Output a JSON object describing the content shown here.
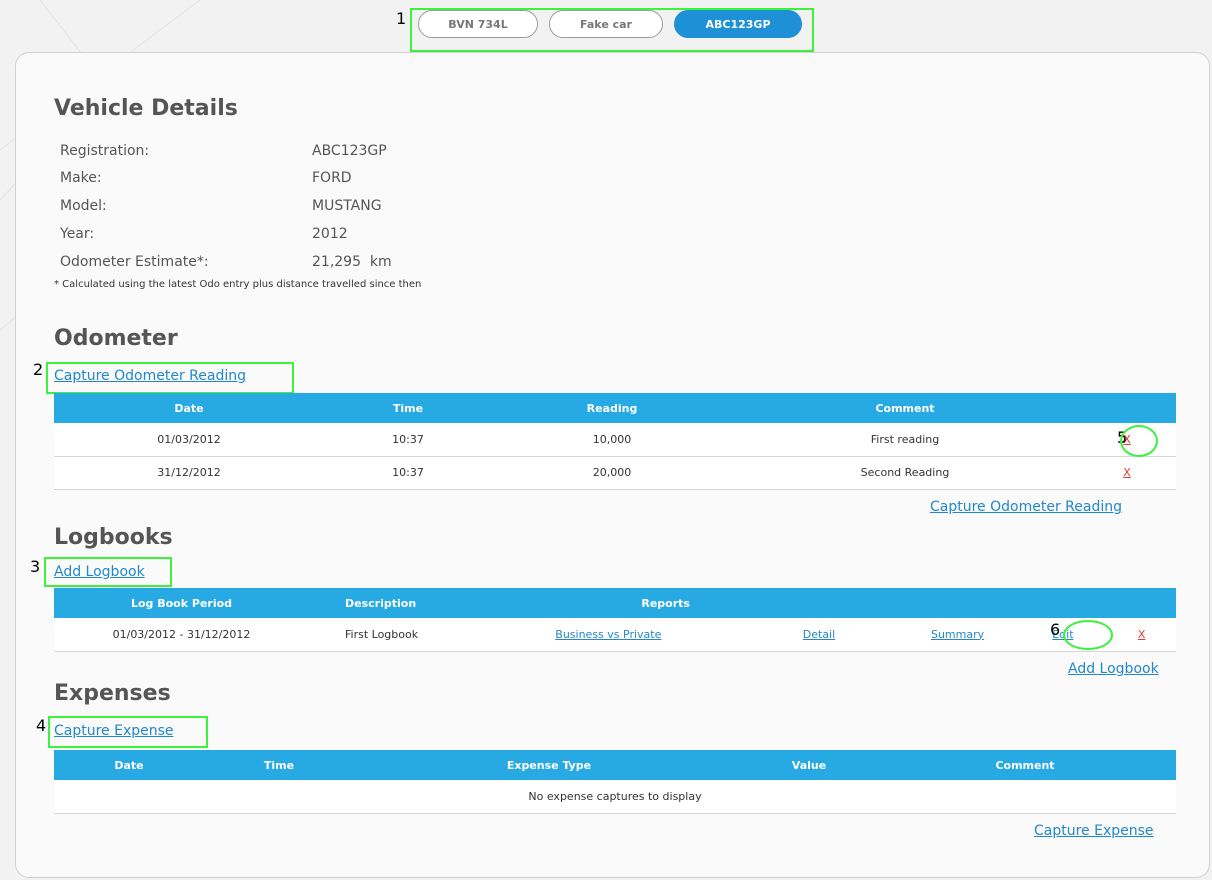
{
  "vehicle_tabs": [
    {
      "label": "BVN 734L",
      "active": false
    },
    {
      "label": "Fake car",
      "active": false
    },
    {
      "label": "ABC123GP",
      "active": true
    }
  ],
  "annotations": [
    "1",
    "2",
    "3",
    "4",
    "5",
    "6"
  ],
  "vehicle_details": {
    "title": "Vehicle Details",
    "fields": [
      {
        "label": "Registration:",
        "value": "ABC123GP"
      },
      {
        "label": "Make:",
        "value": "FORD"
      },
      {
        "label": "Model:",
        "value": "MUSTANG"
      },
      {
        "label": "Year:",
        "value": "2012"
      },
      {
        "label": "Odometer Estimate*:",
        "value": "21,295  km"
      }
    ],
    "note": "* Calculated using the latest Odo entry plus distance travelled since then"
  },
  "odometer": {
    "title": "Odometer",
    "capture_link": "Capture Odometer Reading",
    "columns": [
      "Date",
      "Time",
      "Reading",
      "Comment"
    ],
    "rows": [
      {
        "date": "01/03/2012",
        "time": "10:37",
        "reading": "10,000",
        "comment": "First reading",
        "delete": "X"
      },
      {
        "date": "31/12/2012",
        "time": "10:37",
        "reading": "20,000",
        "comment": "Second Reading",
        "delete": "X"
      }
    ]
  },
  "logbooks": {
    "title": "Logbooks",
    "add_link": "Add Logbook",
    "columns": [
      "Log Book Period",
      "Description",
      "Reports"
    ],
    "rows": [
      {
        "period": "01/03/2012 - 31/12/2012",
        "description": "First Logbook",
        "report_business": "Business vs Private",
        "report_detail": "Detail",
        "report_summary": "Summary",
        "edit": "Edit",
        "delete": "X"
      }
    ]
  },
  "expenses": {
    "title": "Expenses",
    "capture_link": "Capture Expense",
    "columns": [
      "Date",
      "Time",
      "Expense Type",
      "Value",
      "Comment"
    ],
    "empty_message": "No expense captures to display"
  },
  "colors": {
    "header_blue": "#27a9e3",
    "link_blue": "#2188c9",
    "highlight_green": "#3cf23c",
    "delete_red": "#e53935"
  }
}
